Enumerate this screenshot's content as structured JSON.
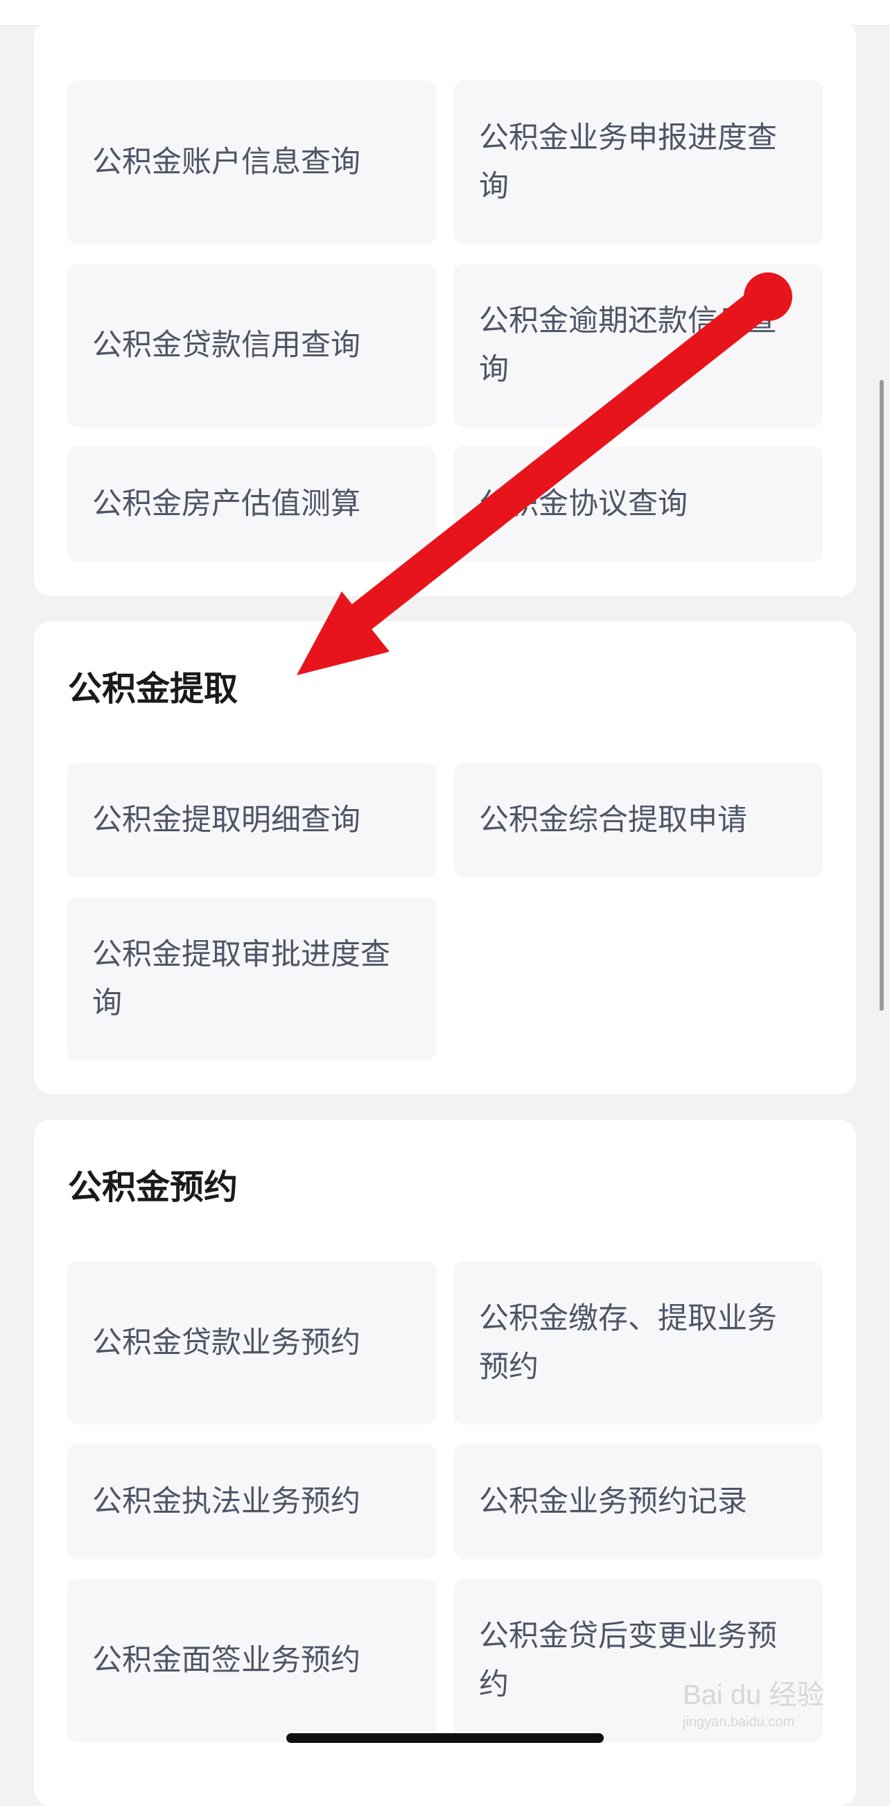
{
  "sections": [
    {
      "title": "",
      "items": [
        "公积金账户信息查询",
        "公积金业务申报进度查询",
        "公积金贷款信用查询",
        "公积金逾期还款信息查询",
        "公积金房产估值测算",
        "公积金协议查询"
      ]
    },
    {
      "title": "公积金提取",
      "items": [
        "公积金提取明细查询",
        "公积金综合提取申请",
        "公积金提取审批进度查询"
      ]
    },
    {
      "title": "公积金预约",
      "items": [
        "公积金贷款业务预约",
        "公积金缴存、提取业务预约",
        "公积金执法业务预约",
        "公积金业务预约记录",
        "公积金面签业务预约",
        "公积金贷后变更业务预约"
      ]
    }
  ],
  "annotation": {
    "arrow_color": "#e8141b"
  },
  "watermark": {
    "brand": "Bai du 经验",
    "url": "jingyan.baidu.com"
  }
}
